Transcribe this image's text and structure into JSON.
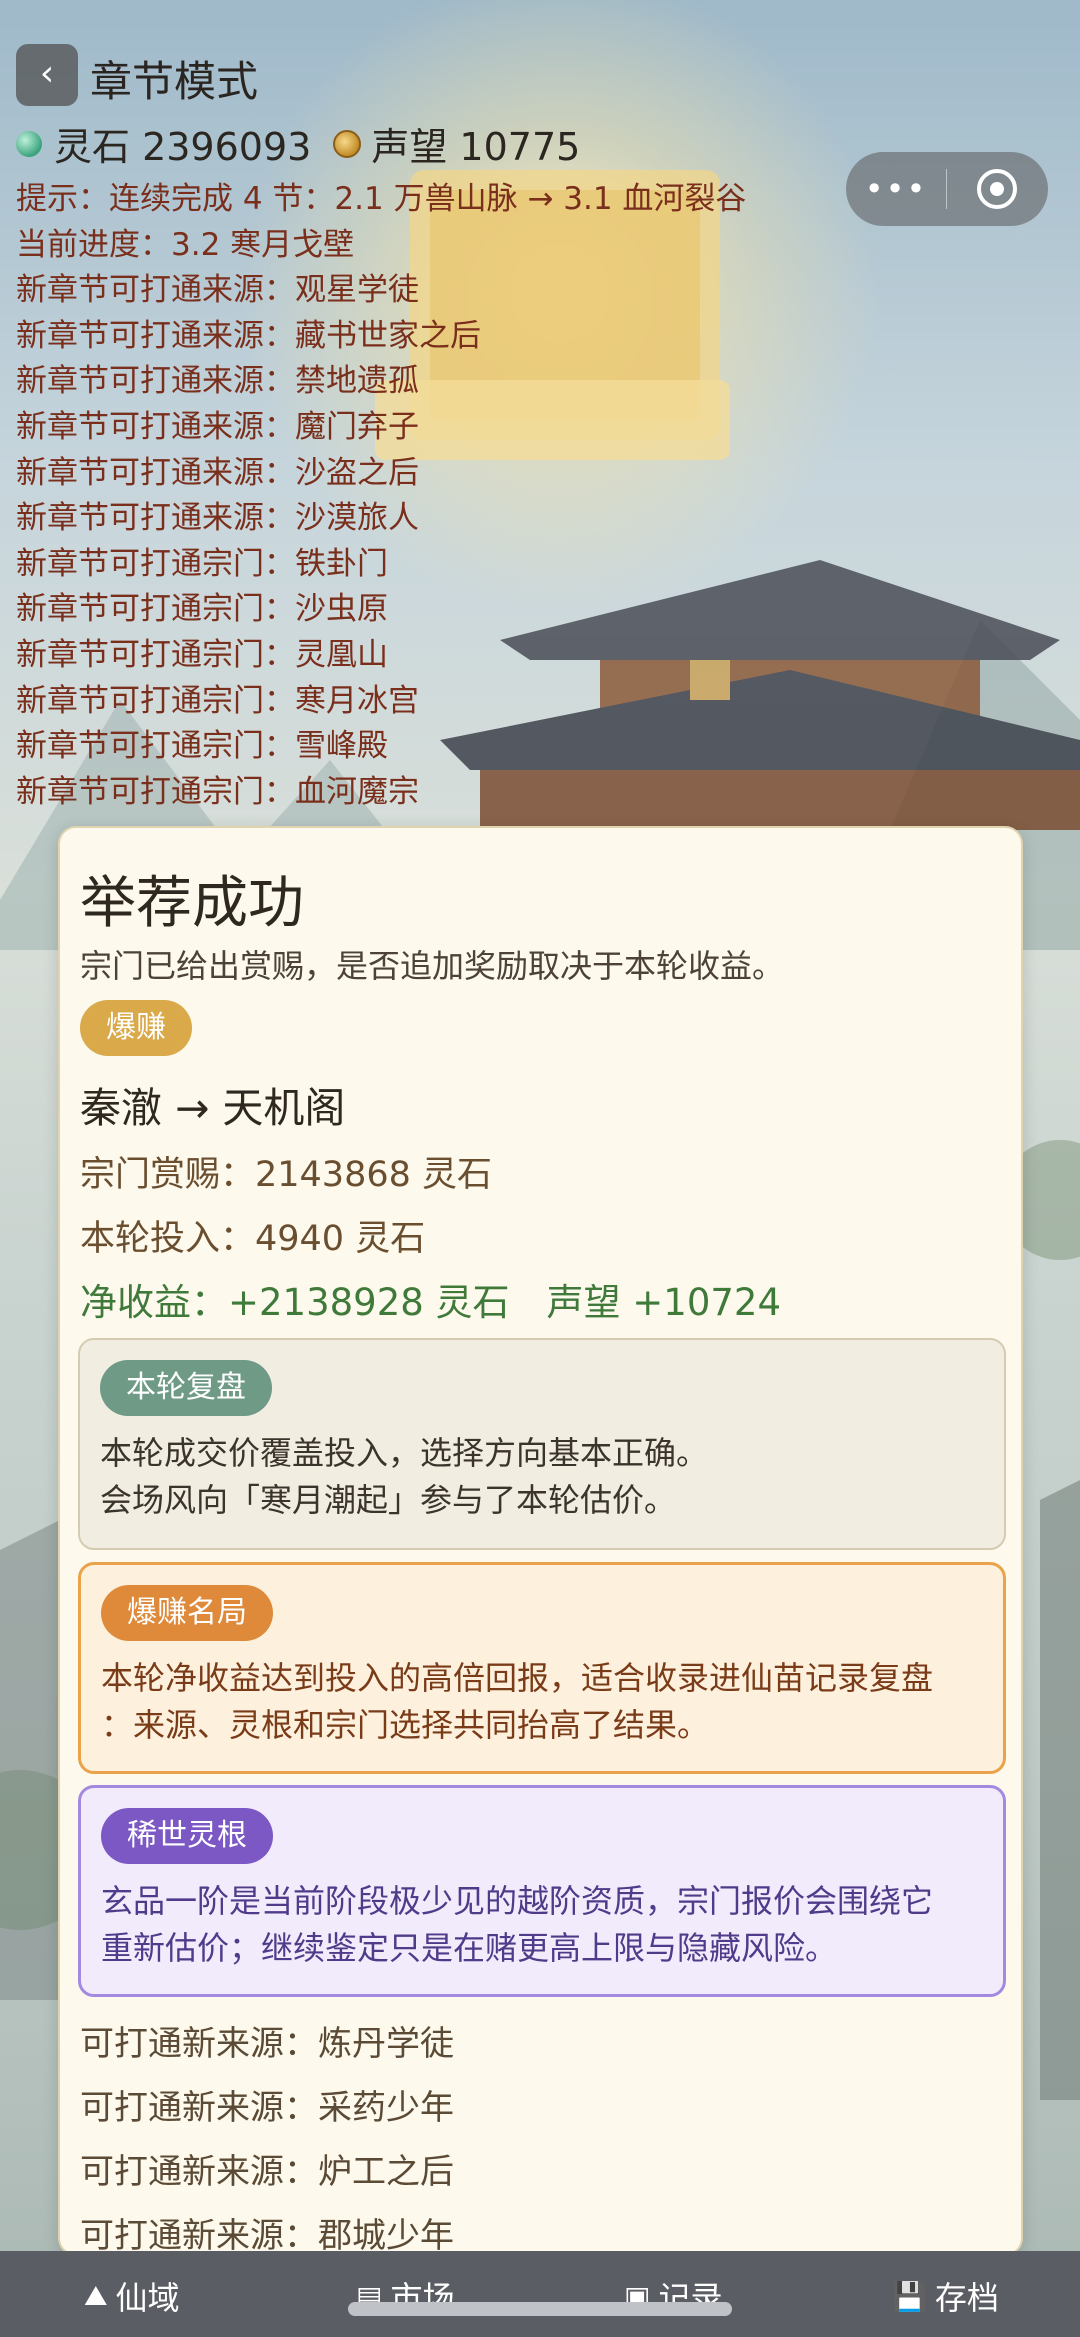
{
  "header": {
    "back_label": "‹",
    "title": "章节模式"
  },
  "resources": {
    "spirit_stone_label": "灵石 2396093",
    "prestige_label": "声望 10775"
  },
  "capsule": {
    "more_label": "•••"
  },
  "info_lines": [
    "提示：连续完成 4 节：2.1 万兽山脉 → 3.1 血河裂谷",
    "当前进度：3.2 寒月戈壁",
    "新章节可打通来源：观星学徒",
    "新章节可打通来源：藏书世家之后",
    "新章节可打通来源：禁地遗孤",
    "新章节可打通来源：魔门弃子",
    "新章节可打通来源：沙盗之后",
    "新章节可打通来源：沙漠旅人",
    "新章节可打通宗门：铁卦门",
    "新章节可打通宗门：沙虫原",
    "新章节可打通宗门：灵凰山",
    "新章节可打通宗门：寒月冰宫",
    "新章节可打通宗门：雪峰殿",
    "新章节可打通宗门：血河魔宗"
  ],
  "result_card": {
    "title": "举荐成功",
    "subtitle": "宗门已给出赏赐，是否追加奖励取决于本轮收益。",
    "badge": "爆赚",
    "pair": "秦澈 → 天机阁",
    "reward": "宗门赏赐：2143868 灵石",
    "investment": "本轮投入：4940 灵石",
    "net": "净收益：+2138928 灵石　声望 +10724",
    "review": {
      "label": "本轮复盘",
      "line1": "本轮成交价覆盖投入，选择方向基本正确。",
      "line2": "会场风向「寒月潮起」参与了本轮估价。"
    },
    "big_win": {
      "label": "爆赚名局",
      "line1": "本轮净收益达到投入的高倍回报，适合收录进仙苗记录复盘",
      "line2": "：来源、灵根和宗门选择共同抬高了结果。"
    },
    "rare_root": {
      "label": "稀世灵根",
      "line1": "玄品一阶是当前阶段极少见的越阶资质，宗门报价会围绕它",
      "line2": "重新估价；继续鉴定只是在赌更高上限与隐藏风险。"
    },
    "new_sources": [
      "可打通新来源：炼丹学徒",
      "可打通新来源：采药少年",
      "可打通新来源：炉工之后",
      "可打通新来源：郡城少年"
    ]
  },
  "tabbar": {
    "tabs": [
      {
        "icon": "⛰",
        "label": "仙域"
      },
      {
        "icon": "▤",
        "label": "市场"
      },
      {
        "icon": "▣",
        "label": "记录"
      },
      {
        "icon": "💾",
        "label": "存档"
      }
    ]
  },
  "colors": {
    "info_text": "#7a2f1c",
    "net_green": "#3f7a3b",
    "badge_gold": "#d9a94a",
    "review_green": "#6e9a86",
    "big_orange": "#de8a3a",
    "rare_purple": "#7b58c4",
    "tabbar_bg": "#5a5d63"
  }
}
